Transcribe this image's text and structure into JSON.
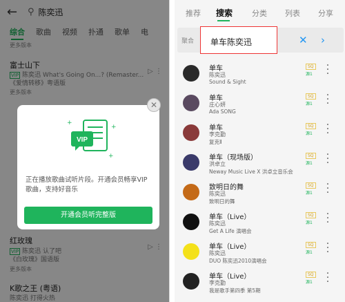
{
  "left": {
    "search_term": "陈奕迅",
    "tabs": [
      "综合",
      "歌曲",
      "视频",
      "扑通",
      "歌单",
      "电"
    ],
    "rows": [
      {
        "more": "更多版本"
      },
      {
        "title": "富士山下",
        "vip": "VIP",
        "artist": "陈奕迅 What's Going On...? (Remaster...",
        "sub": "《爱情转移》粤语版",
        "more": "更多版本"
      },
      {
        "title": "红玫瑰",
        "vip": "VIP",
        "artist": "陈奕迅 认了吧",
        "sub": "《白玫瑰》国语版",
        "more": "更多版本"
      },
      {
        "title": "K歌之王 (粤语)",
        "artist": "陈奕迅 打得火热"
      }
    ],
    "dialog": {
      "text": "正在播放歌曲试听片段。开通会员畅享VIP歌曲，支持好音乐",
      "button": "开通会员听完整版",
      "illus_label": "VIP"
    }
  },
  "right": {
    "tabs": [
      "推荐",
      "搜索",
      "分类",
      "列表",
      "分享"
    ],
    "search_prefix": "聚合",
    "search_value": "单车陈奕迅",
    "songs": [
      {
        "title": "单车",
        "artist": "陈奕迅",
        "album": "Sound & Sight",
        "cover": "#2a2a2a"
      },
      {
        "title": "单车",
        "artist": "庄心妍",
        "album": "Ada SONG",
        "cover": "#5a4a60"
      },
      {
        "title": "单车",
        "artist": "李克勤",
        "album": "复克Ⅱ",
        "cover": "#8a3a3a"
      },
      {
        "title": "单车（现场版）",
        "artist": "洪卓立",
        "album": "Neway Music Live X 洪卓立音乐会",
        "cover": "#3a3a6a"
      },
      {
        "title": "致明日的舞",
        "artist": "陈奕迅",
        "album": "致明日的舞",
        "cover": "#c46a18"
      },
      {
        "title": "单车（Live）",
        "artist": "陈奕迅",
        "album": "Get A Life 演唱会",
        "cover": "#111111"
      },
      {
        "title": "单车（Live）",
        "artist": "陈奕迅",
        "album": "DUO 陈奕迅2010演唱会",
        "cover": "#f4e11a"
      },
      {
        "title": "单车（Live）",
        "artist": "李克勤",
        "album": "我是歌手第四季 第5期",
        "cover": "#222222"
      }
    ],
    "badge_top": "SQ",
    "badge_bottom": "源1"
  }
}
